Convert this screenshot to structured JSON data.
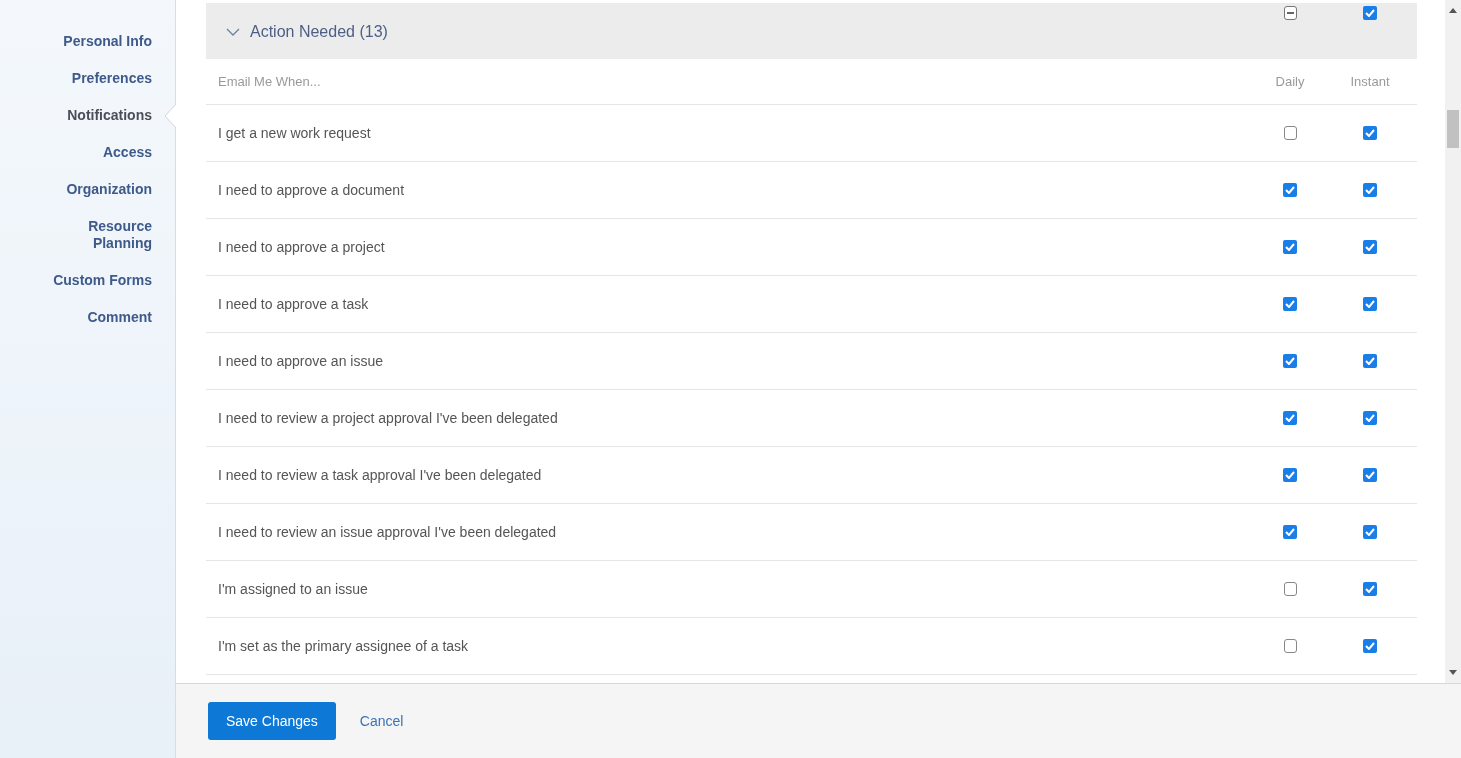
{
  "sidebar": {
    "items": [
      {
        "label": "Personal Info",
        "selected": false
      },
      {
        "label": "Preferences",
        "selected": false
      },
      {
        "label": "Notifications",
        "selected": true
      },
      {
        "label": "Access",
        "selected": false
      },
      {
        "label": "Organization",
        "selected": false
      },
      {
        "label": "Resource Planning",
        "selected": false
      },
      {
        "label": "Custom Forms",
        "selected": false
      },
      {
        "label": "Comment",
        "selected": false
      }
    ]
  },
  "section": {
    "title": "Action Needed (13)",
    "expanded": true,
    "daily_indeterminate": true,
    "instant": true
  },
  "table": {
    "columns": [
      "Email Me When...",
      "Daily",
      "Instant"
    ],
    "rows": [
      {
        "label": "I get a new work request",
        "daily": false,
        "instant": true
      },
      {
        "label": "I need to approve a document",
        "daily": true,
        "instant": true
      },
      {
        "label": "I need to approve a project",
        "daily": true,
        "instant": true
      },
      {
        "label": "I need to approve a task",
        "daily": true,
        "instant": true
      },
      {
        "label": "I need to approve an issue",
        "daily": true,
        "instant": true
      },
      {
        "label": "I need to review a project approval I've been delegated",
        "daily": true,
        "instant": true
      },
      {
        "label": "I need to review a task approval I've been delegated",
        "daily": true,
        "instant": true
      },
      {
        "label": "I need to review an issue approval I've been delegated",
        "daily": true,
        "instant": true
      },
      {
        "label": "I'm assigned to an issue",
        "daily": false,
        "instant": true
      },
      {
        "label": "I'm set as the primary assignee of a task",
        "daily": false,
        "instant": true
      }
    ]
  },
  "footer": {
    "buttons": [
      {
        "label": "Save Changes",
        "kind": "primary"
      },
      {
        "label": "Cancel",
        "kind": "link"
      }
    ]
  }
}
